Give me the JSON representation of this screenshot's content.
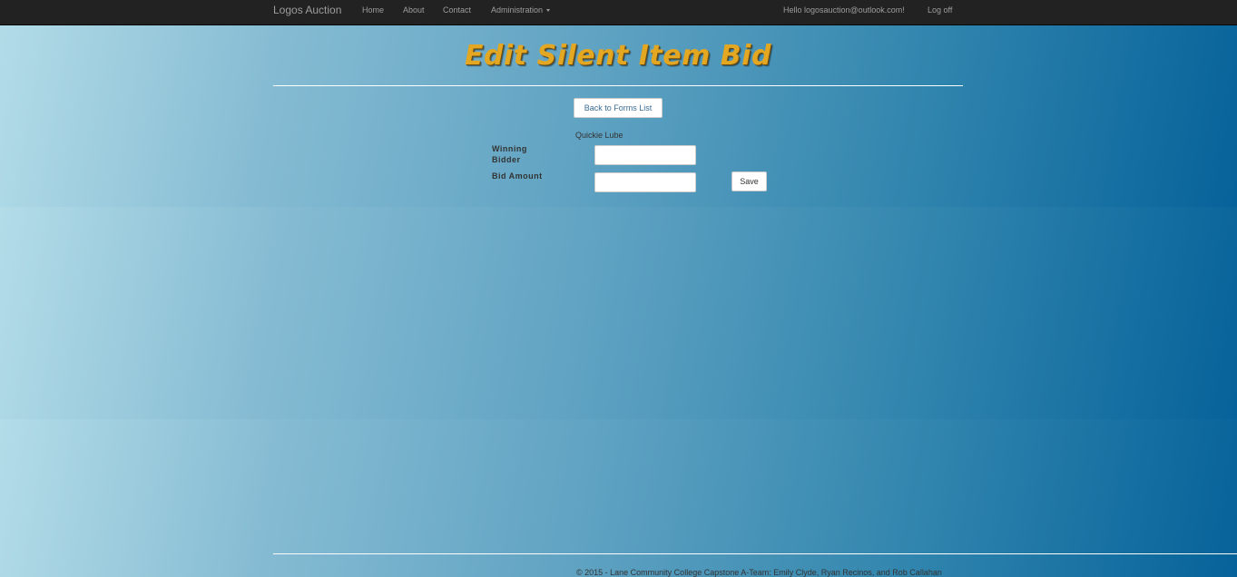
{
  "navbar": {
    "brand": "Logos Auction",
    "links": {
      "home": "Home",
      "about": "About",
      "contact": "Contact",
      "administration": "Administration"
    },
    "greeting": "Hello logosauction@outlook.com!",
    "logoff": "Log off"
  },
  "page": {
    "title": "Edit Silent Item Bid",
    "back_label": "Back to Forms List",
    "item_name": "Quickie Lube"
  },
  "form": {
    "winning_bidder": {
      "label": "Winning Bidder",
      "value": ""
    },
    "bid_amount": {
      "label": "Bid Amount",
      "value": ""
    },
    "save_label": "Save"
  },
  "footer": {
    "text": "© 2015 - Lane Community College Capstone A-Team: Emily Clyde, Ryan Recinos, and Rob Callahan"
  },
  "colors": {
    "navbar_bg": "#222222",
    "title": "#e3a722",
    "gradient_start": "#b3dce8",
    "gradient_end": "#06629a"
  }
}
